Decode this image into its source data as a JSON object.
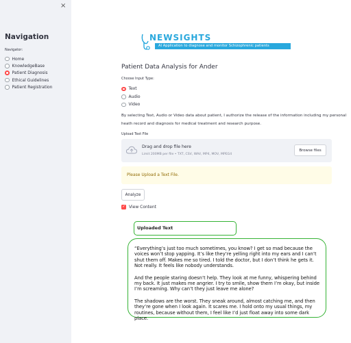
{
  "sidebar": {
    "close_icon": "×",
    "title": "Navigation",
    "nav_label": "Navigator:",
    "items": [
      {
        "label": "Home",
        "selected": false
      },
      {
        "label": "KnowledgeBase",
        "selected": false
      },
      {
        "label": "Patient Diagnosis",
        "selected": true
      },
      {
        "label": "Ethical Guidelines",
        "selected": false
      },
      {
        "label": "Patient Registration",
        "selected": false
      }
    ]
  },
  "logo": {
    "name": "NEWSIGHTS",
    "tagline": "AI Application to diagnose and monitor Schizophrenic patients",
    "color": "#29a8dd"
  },
  "main": {
    "title": "Patient Data Analysis for Ander",
    "input_type_label": "Choose Input Type:",
    "input_types": [
      {
        "label": "Text",
        "selected": true
      },
      {
        "label": "Audio",
        "selected": false
      },
      {
        "label": "Video",
        "selected": false
      }
    ],
    "consent_text": "By selecting Text, Audio or Video data about patient, I authorize the release of the information including my personal heath record and diagnosis for medical treatment and research purpose.",
    "upload_label": "Upload Text File",
    "uploader": {
      "drag_text": "Drag and drop file here",
      "limit_text": "Limit 200MB per file • TXT, CSV, WAV, MP4, MOV, MPEG4",
      "browse_label": "Browse files",
      "icon": "cloud-upload-icon"
    },
    "warning": "Please Upload a Text File.",
    "analyze_label": "Analyze",
    "view_content_label": "View Content",
    "view_content_checked": true,
    "uploaded_header": "Uploaded Text",
    "uploaded_paragraphs": [
      "“Everything’s just too much sometimes, you know? I get so mad because the voices won’t stop yapping. It’s like they’re yelling right into my ears and I can’t shut them off. Makes me so tired. I told the doctor, but I don’t think he gets it. Not really. It feels like nobody understands.",
      "And the people staring doesn’t help. They look at me funny, whispering behind my back. It just makes me angrier. I try to smile, show them I’m okay, but inside I’m screaming. Why can’t they just leave me alone?",
      "The shadows are the worst. They sneak around, almost catching me, and then they’re gone when I look again. It scares me. I hold onto my usual things, my routines, because without them, I feel like I’d just float away into some dark place."
    ]
  },
  "colors": {
    "accent": "#ff4b4b",
    "sidebar_bg": "#f0f2f6",
    "warning_bg": "#fffce7",
    "warning_text": "#926c05",
    "box_border": "#34b233"
  }
}
